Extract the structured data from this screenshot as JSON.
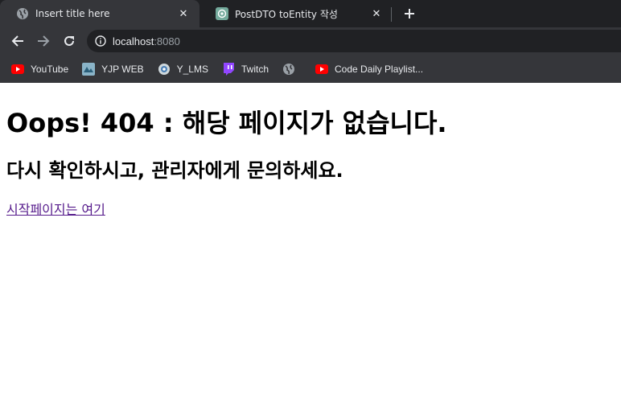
{
  "tabs": [
    {
      "title": "Insert title here",
      "icon": "globe-icon",
      "active": true
    },
    {
      "title": "PostDTO toEntity 작성",
      "icon": "openai-icon",
      "active": false
    }
  ],
  "address_bar": {
    "host": "localhost",
    "port": ":8080"
  },
  "bookmarks": [
    {
      "label": "YouTube",
      "icon": "youtube-icon"
    },
    {
      "label": "YJP WEB",
      "icon": "yjp-icon"
    },
    {
      "label": "Y_LMS",
      "icon": "lms-icon"
    },
    {
      "label": "Twitch",
      "icon": "twitch-icon"
    },
    {
      "label": "",
      "icon": "globe-icon"
    },
    {
      "label": "Code Daily Playlist...",
      "icon": "youtube-icon"
    }
  ],
  "page": {
    "heading": "Oops! 404 : 해당 페이지가 없습니다.",
    "subheading": "다시 확인하시고, 관리자에게 문의하세요.",
    "link_text": "시작페이지는 여기"
  },
  "colors": {
    "chrome_bg": "#35363a",
    "tabstrip_bg": "#202124",
    "link": "#551a8b"
  }
}
